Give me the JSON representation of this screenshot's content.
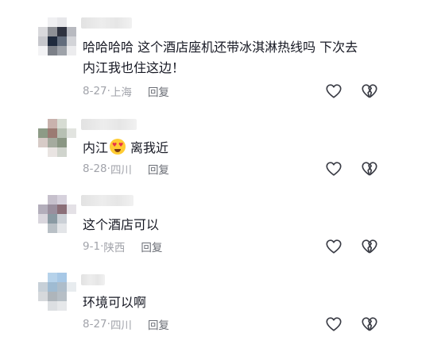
{
  "comments": [
    {
      "text_line1": "哈哈哈哈 这个酒店座机还带冰淇淋热线吗 下次去",
      "text_line2": "内江我也住这边！",
      "date": "8-27",
      "location": "上海",
      "reply_label": "回复",
      "avatar_colors": [
        "#ffffff",
        "#f0f0f2",
        "#e7e7ea",
        "#ffffff",
        "#d9d9dc",
        "#8e9096",
        "#2f3340",
        "#b8bac0",
        "#c6c7cc",
        "#1f2a3d",
        "#626c7c",
        "#d3d4d8",
        "#f3f3f5",
        "#7c8088",
        "#9ea2a9",
        "#ececee"
      ],
      "username_width": 64
    },
    {
      "text_before_emoji": "内江",
      "emoji": "heart-eyes-emoji",
      "text_after_emoji": "离我近",
      "date": "8-28",
      "location": "四川",
      "reply_label": "回复",
      "avatar_colors": [
        "#ffffff",
        "#c9b2ad",
        "#d7dcd3",
        "#ffffff",
        "#8d9b86",
        "#9b7b73",
        "#b7c0b3",
        "#e2e4e0",
        "#d7cbc7",
        "#a5ab9f",
        "#8a9683",
        "#ffffff",
        "#ffffff",
        "#e9e4e2",
        "#d0d4cd",
        "#ffffff"
      ],
      "username_width": 70
    },
    {
      "text": "这个酒店可以",
      "date": "9-1",
      "location": "陕西",
      "reply_label": "回复",
      "avatar_colors": [
        "#ffffff",
        "#c6c0cc",
        "#d6d1dc",
        "#ffffff",
        "#b3aebb",
        "#9a8f9e",
        "#8b6f78",
        "#e4e1e6",
        "#d9d6dd",
        "#8a9aa3",
        "#cbd0d6",
        "#ffffff",
        "#ffffff",
        "#b9c0c6",
        "#e3e5e8",
        "#ffffff"
      ],
      "username_width": 66
    },
    {
      "text": "环境可以啊",
      "date": "8-27",
      "location": "四川",
      "reply_label": "回复",
      "avatar_colors": [
        "#ffffff",
        "#b6d2ea",
        "#a7c8e6",
        "#ffffff",
        "#c7d0d8",
        "#9fbbd2",
        "#aebdca",
        "#e8ecef",
        "#d6d9dc",
        "#aeb5bb",
        "#b7bfc6",
        "#ffffff",
        "#ffffff",
        "#dcdfe2",
        "#e6e8ea",
        "#ffffff"
      ],
      "username_width": 30
    }
  ],
  "icons": {
    "like": "heart-outline-icon",
    "dislike": "broken-heart-icon"
  }
}
